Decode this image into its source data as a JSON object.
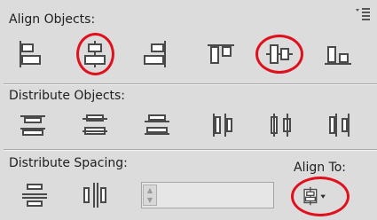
{
  "panel": {
    "sections": {
      "align": {
        "title": "Align Objects:"
      },
      "distribute": {
        "title": "Distribute Objects:"
      },
      "spacing": {
        "title": "Distribute Spacing:"
      }
    },
    "align_to": {
      "label": "Align To:"
    },
    "spacing_value": "",
    "colors": {
      "highlight_ring": "#e0101c",
      "panel_bg": "#dcdcdc",
      "icon_dark": "#4a4a4a"
    }
  },
  "icons": {
    "align": [
      "align-left-edges-icon",
      "align-horizontal-centers-icon",
      "align-right-edges-icon",
      "align-top-edges-icon",
      "align-vertical-centers-icon",
      "align-bottom-edges-icon"
    ],
    "distribute": [
      "distribute-top-icon",
      "distribute-vertical-centers-icon",
      "distribute-bottom-icon",
      "distribute-left-icon",
      "distribute-horizontal-centers-icon",
      "distribute-right-icon"
    ],
    "spacing": [
      "vertical-distribute-space-icon",
      "horizontal-distribute-space-icon"
    ],
    "align_to": "align-to-key-object-icon",
    "menu": "panel-menu-icon"
  }
}
